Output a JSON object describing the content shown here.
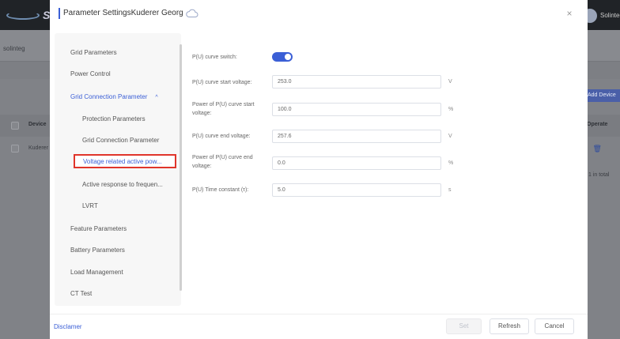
{
  "background": {
    "logo_letter": "S",
    "username": "Solinteg",
    "tab_label": "solinteg",
    "add_device_label": "Add Device",
    "table": {
      "headers": {
        "device": "Device",
        "operate": "Operate"
      },
      "rows": [
        {
          "device": "Kuderer"
        }
      ],
      "total_text": "1 in total"
    }
  },
  "modal": {
    "title": "Parameter SettingsKuderer Georg",
    "close_glyph": "×",
    "nav": [
      {
        "label": "Grid Parameters"
      },
      {
        "label": "Power Control"
      },
      {
        "label": "Grid Connection Parameter",
        "caret": "^"
      },
      {
        "label": "Protection Parameters"
      },
      {
        "label": "Grid Connection Parameter"
      },
      {
        "label": "Voltage related active pow..."
      },
      {
        "label": "Active response to frequen..."
      },
      {
        "label": "LVRT"
      },
      {
        "label": "Feature Parameters"
      },
      {
        "label": "Battery Parameters"
      },
      {
        "label": "Load Management"
      },
      {
        "label": "CT Test"
      }
    ],
    "form": {
      "switch_label": "P(U) curve switch:",
      "switch_on": true,
      "fields": [
        {
          "label": "P(U) curve start voltage:",
          "value": "253.0",
          "unit": "V"
        },
        {
          "label": "Power of P(U) curve start voltage:",
          "value": "100.0",
          "unit": "%"
        },
        {
          "label": "P(U) curve end voltage:",
          "value": "257.6",
          "unit": "V"
        },
        {
          "label": "Power of P(U) curve end voltage:",
          "value": "0.0",
          "unit": "%"
        },
        {
          "label": "P(U) Time constant (τ):",
          "value": "5.0",
          "unit": "s"
        }
      ]
    },
    "footer": {
      "disclaimer": "Disclamer",
      "set_label": "Set",
      "refresh_label": "Refresh",
      "cancel_label": "Cancel"
    }
  },
  "colors": {
    "accent": "#3b5fd6",
    "highlight_border": "#e0352b",
    "overlay": "#7d7f84"
  }
}
